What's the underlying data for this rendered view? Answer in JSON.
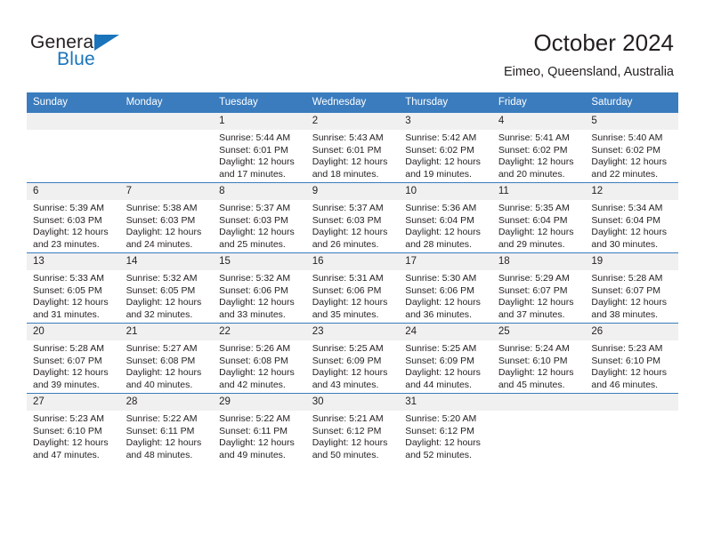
{
  "brand": {
    "name_part1": "General",
    "name_part2": "Blue",
    "logo_icon": "triangle-flag-icon"
  },
  "header": {
    "title": "October 2024",
    "location": "Eimeo, Queensland, Australia"
  },
  "calendar": {
    "weekday_headers": [
      "Sunday",
      "Monday",
      "Tuesday",
      "Wednesday",
      "Thursday",
      "Friday",
      "Saturday"
    ],
    "accent_color": "#3a7cbe",
    "daynum_bg": "#f0f0f0",
    "weeks": [
      [
        {
          "day": "",
          "sunrise": "",
          "sunset": "",
          "daylight": "",
          "empty": true
        },
        {
          "day": "",
          "sunrise": "",
          "sunset": "",
          "daylight": "",
          "empty": true
        },
        {
          "day": "1",
          "sunrise": "Sunrise: 5:44 AM",
          "sunset": "Sunset: 6:01 PM",
          "daylight": "Daylight: 12 hours and 17 minutes."
        },
        {
          "day": "2",
          "sunrise": "Sunrise: 5:43 AM",
          "sunset": "Sunset: 6:01 PM",
          "daylight": "Daylight: 12 hours and 18 minutes."
        },
        {
          "day": "3",
          "sunrise": "Sunrise: 5:42 AM",
          "sunset": "Sunset: 6:02 PM",
          "daylight": "Daylight: 12 hours and 19 minutes."
        },
        {
          "day": "4",
          "sunrise": "Sunrise: 5:41 AM",
          "sunset": "Sunset: 6:02 PM",
          "daylight": "Daylight: 12 hours and 20 minutes."
        },
        {
          "day": "5",
          "sunrise": "Sunrise: 5:40 AM",
          "sunset": "Sunset: 6:02 PM",
          "daylight": "Daylight: 12 hours and 22 minutes."
        }
      ],
      [
        {
          "day": "6",
          "sunrise": "Sunrise: 5:39 AM",
          "sunset": "Sunset: 6:03 PM",
          "daylight": "Daylight: 12 hours and 23 minutes."
        },
        {
          "day": "7",
          "sunrise": "Sunrise: 5:38 AM",
          "sunset": "Sunset: 6:03 PM",
          "daylight": "Daylight: 12 hours and 24 minutes."
        },
        {
          "day": "8",
          "sunrise": "Sunrise: 5:37 AM",
          "sunset": "Sunset: 6:03 PM",
          "daylight": "Daylight: 12 hours and 25 minutes."
        },
        {
          "day": "9",
          "sunrise": "Sunrise: 5:37 AM",
          "sunset": "Sunset: 6:03 PM",
          "daylight": "Daylight: 12 hours and 26 minutes."
        },
        {
          "day": "10",
          "sunrise": "Sunrise: 5:36 AM",
          "sunset": "Sunset: 6:04 PM",
          "daylight": "Daylight: 12 hours and 28 minutes."
        },
        {
          "day": "11",
          "sunrise": "Sunrise: 5:35 AM",
          "sunset": "Sunset: 6:04 PM",
          "daylight": "Daylight: 12 hours and 29 minutes."
        },
        {
          "day": "12",
          "sunrise": "Sunrise: 5:34 AM",
          "sunset": "Sunset: 6:04 PM",
          "daylight": "Daylight: 12 hours and 30 minutes."
        }
      ],
      [
        {
          "day": "13",
          "sunrise": "Sunrise: 5:33 AM",
          "sunset": "Sunset: 6:05 PM",
          "daylight": "Daylight: 12 hours and 31 minutes."
        },
        {
          "day": "14",
          "sunrise": "Sunrise: 5:32 AM",
          "sunset": "Sunset: 6:05 PM",
          "daylight": "Daylight: 12 hours and 32 minutes."
        },
        {
          "day": "15",
          "sunrise": "Sunrise: 5:32 AM",
          "sunset": "Sunset: 6:06 PM",
          "daylight": "Daylight: 12 hours and 33 minutes."
        },
        {
          "day": "16",
          "sunrise": "Sunrise: 5:31 AM",
          "sunset": "Sunset: 6:06 PM",
          "daylight": "Daylight: 12 hours and 35 minutes."
        },
        {
          "day": "17",
          "sunrise": "Sunrise: 5:30 AM",
          "sunset": "Sunset: 6:06 PM",
          "daylight": "Daylight: 12 hours and 36 minutes."
        },
        {
          "day": "18",
          "sunrise": "Sunrise: 5:29 AM",
          "sunset": "Sunset: 6:07 PM",
          "daylight": "Daylight: 12 hours and 37 minutes."
        },
        {
          "day": "19",
          "sunrise": "Sunrise: 5:28 AM",
          "sunset": "Sunset: 6:07 PM",
          "daylight": "Daylight: 12 hours and 38 minutes."
        }
      ],
      [
        {
          "day": "20",
          "sunrise": "Sunrise: 5:28 AM",
          "sunset": "Sunset: 6:07 PM",
          "daylight": "Daylight: 12 hours and 39 minutes."
        },
        {
          "day": "21",
          "sunrise": "Sunrise: 5:27 AM",
          "sunset": "Sunset: 6:08 PM",
          "daylight": "Daylight: 12 hours and 40 minutes."
        },
        {
          "day": "22",
          "sunrise": "Sunrise: 5:26 AM",
          "sunset": "Sunset: 6:08 PM",
          "daylight": "Daylight: 12 hours and 42 minutes."
        },
        {
          "day": "23",
          "sunrise": "Sunrise: 5:25 AM",
          "sunset": "Sunset: 6:09 PM",
          "daylight": "Daylight: 12 hours and 43 minutes."
        },
        {
          "day": "24",
          "sunrise": "Sunrise: 5:25 AM",
          "sunset": "Sunset: 6:09 PM",
          "daylight": "Daylight: 12 hours and 44 minutes."
        },
        {
          "day": "25",
          "sunrise": "Sunrise: 5:24 AM",
          "sunset": "Sunset: 6:10 PM",
          "daylight": "Daylight: 12 hours and 45 minutes."
        },
        {
          "day": "26",
          "sunrise": "Sunrise: 5:23 AM",
          "sunset": "Sunset: 6:10 PM",
          "daylight": "Daylight: 12 hours and 46 minutes."
        }
      ],
      [
        {
          "day": "27",
          "sunrise": "Sunrise: 5:23 AM",
          "sunset": "Sunset: 6:10 PM",
          "daylight": "Daylight: 12 hours and 47 minutes."
        },
        {
          "day": "28",
          "sunrise": "Sunrise: 5:22 AM",
          "sunset": "Sunset: 6:11 PM",
          "daylight": "Daylight: 12 hours and 48 minutes."
        },
        {
          "day": "29",
          "sunrise": "Sunrise: 5:22 AM",
          "sunset": "Sunset: 6:11 PM",
          "daylight": "Daylight: 12 hours and 49 minutes."
        },
        {
          "day": "30",
          "sunrise": "Sunrise: 5:21 AM",
          "sunset": "Sunset: 6:12 PM",
          "daylight": "Daylight: 12 hours and 50 minutes."
        },
        {
          "day": "31",
          "sunrise": "Sunrise: 5:20 AM",
          "sunset": "Sunset: 6:12 PM",
          "daylight": "Daylight: 12 hours and 52 minutes."
        },
        {
          "day": "",
          "sunrise": "",
          "sunset": "",
          "daylight": "",
          "empty": true
        },
        {
          "day": "",
          "sunrise": "",
          "sunset": "",
          "daylight": "",
          "empty": true
        }
      ]
    ]
  }
}
